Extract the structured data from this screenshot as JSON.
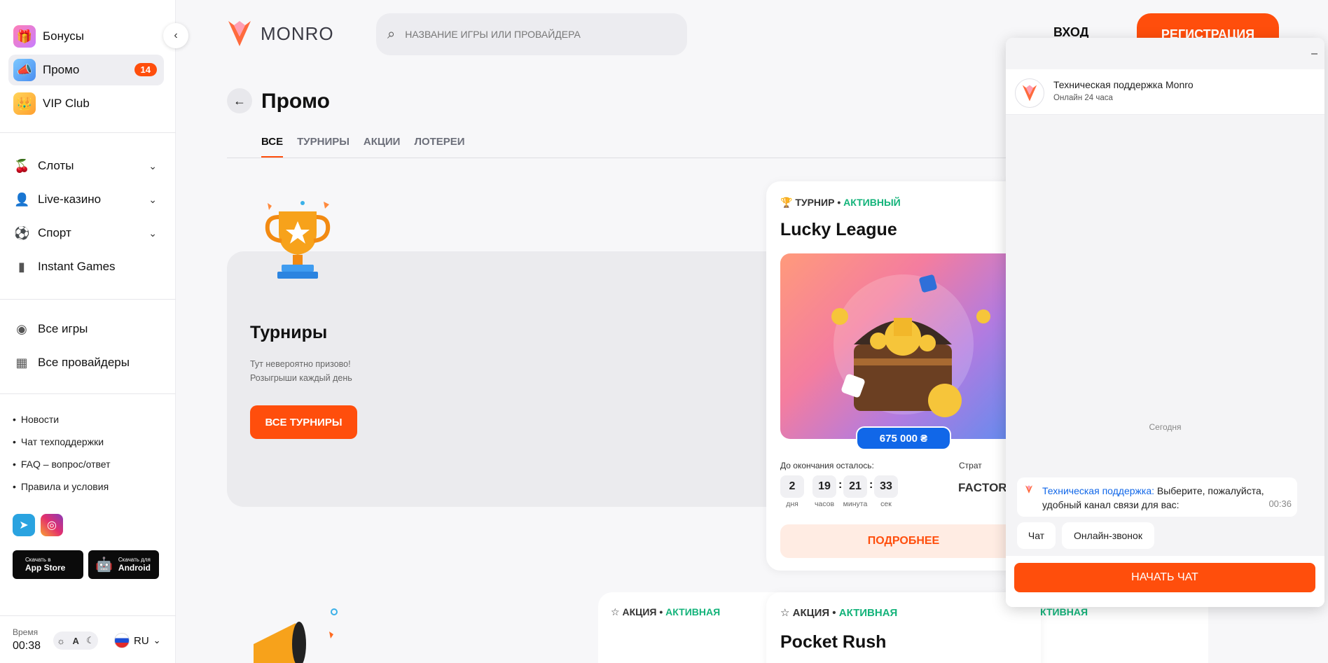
{
  "sidebar": {
    "top_items": [
      {
        "label": "Бонусы",
        "icon": "gift-icon"
      },
      {
        "label": "Промо",
        "icon": "promo-icon",
        "badge": "14"
      },
      {
        "label": "VIP Club",
        "icon": "crown-icon"
      }
    ],
    "categories": [
      {
        "label": "Слоты",
        "icon": "cherry-icon"
      },
      {
        "label": "Live-казино",
        "icon": "dealer-icon"
      },
      {
        "label": "Спорт",
        "icon": "ball-icon"
      },
      {
        "label": "Instant Games",
        "icon": "chart-bars-icon"
      }
    ],
    "all_items": [
      {
        "label": "Все игры",
        "icon": "compass-icon"
      },
      {
        "label": "Все провайдеры",
        "icon": "grid-icon"
      }
    ],
    "links": [
      "Новости",
      "Чат техподдержки",
      "FAQ – вопрос/ответ",
      "Правила и условия"
    ],
    "app_store": {
      "small": "Скачать в",
      "big": "App Store"
    },
    "android": {
      "small": "Скачать для",
      "big": "Android"
    },
    "time_label": "Время",
    "time_value": "00:38",
    "theme_letter": "A",
    "lang": "RU"
  },
  "header": {
    "logo_text": "MONRO",
    "search_placeholder": "НАЗВАНИЕ ИГРЫ ИЛИ ПРОВАЙДЕРА",
    "login": "ВХОД",
    "register": "РЕГИСТРАЦИЯ"
  },
  "page": {
    "title": "Промо",
    "tabs": [
      "ВСЕ",
      "ТУРНИРЫ",
      "АКЦИИ",
      "ЛОТЕРЕИ"
    ]
  },
  "tournaments": {
    "title": "Турниры",
    "desc_line1": "Тут невероятно призово!",
    "desc_line2": "Розыгрыши каждый день",
    "button": "ВСЕ ТУРНИРЫ"
  },
  "lucky_card": {
    "type": "ТУРНИР",
    "status": "АКТИВНЫЙ",
    "title": "Lucky League",
    "prize": "675 000 ₴",
    "countdown_label": "До окончания осталось:",
    "days": "2",
    "days_unit": "дня",
    "hours": "19",
    "hours_unit": "часов",
    "minutes": "21",
    "minutes_unit": "минута",
    "seconds": "33",
    "seconds_unit": "сек",
    "strategy_label": "Страт",
    "strategy_value": "FACTOR",
    "more": "ПОДРОБНЕЕ"
  },
  "lower_cards": {
    "left_type": "АКЦИЯ",
    "left_status": "АКТИВНАЯ",
    "middle_type": "АКЦИЯ",
    "middle_status": "АКТИВНАЯ",
    "middle_title": "Pocket Rush",
    "right_status": "АКТИВНАЯ"
  },
  "chat": {
    "agent_name": "Техническая поддержка Monro",
    "agent_status": "Онлайн 24 часа",
    "today": "Сегодня",
    "sender": "Техническая поддержка:",
    "message": "Выберите, пожалуйста, удобный канал связи для вас:",
    "time": "00:36",
    "chips": [
      "Чат",
      "Онлайн-звонок"
    ],
    "start": "НАЧАТЬ ЧАТ"
  },
  "colors": {
    "accent": "#ff4e0c",
    "active_green": "#13b37a",
    "link_blue": "#1167e8"
  }
}
